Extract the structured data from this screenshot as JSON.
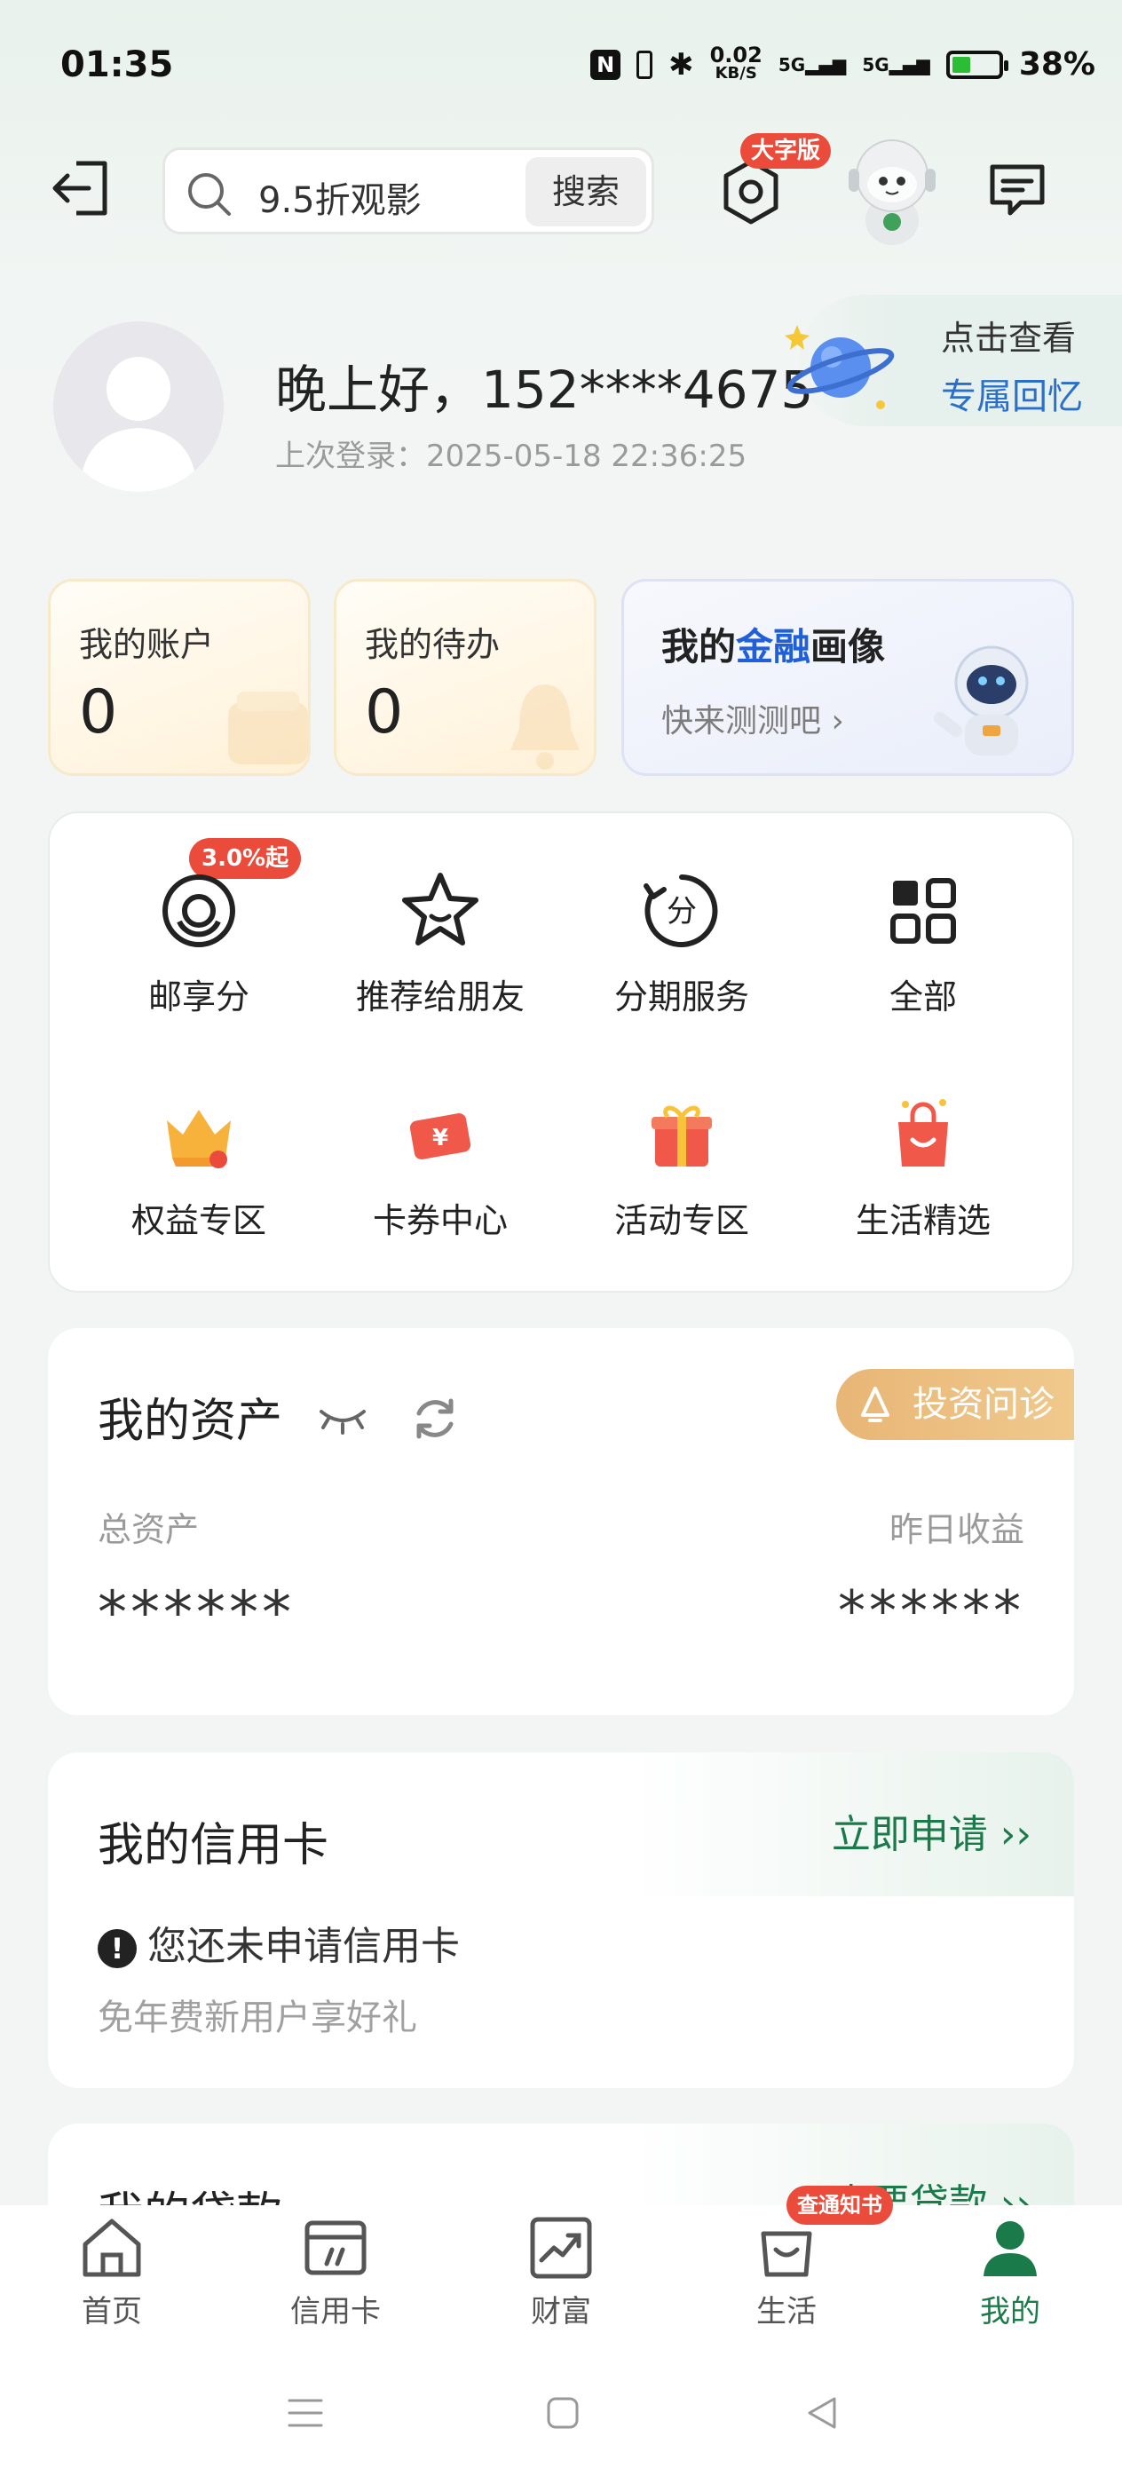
{
  "status_bar": {
    "time": "01:35",
    "net_speed": "0.02",
    "net_unit": "KB/S",
    "signal1": "5G",
    "signal2": "5G",
    "battery": "38%"
  },
  "header": {
    "search_placeholder": "9.5折观影",
    "search_button": "搜索",
    "large_font_badge": "大字版"
  },
  "greeting": {
    "text": "晚上好，152****4675",
    "last_login": "上次登录：2025-05-18 22:36:25",
    "memory_line1": "点击查看",
    "memory_line2": "专属回忆"
  },
  "summary": {
    "account_title": "我的账户",
    "account_value": "0",
    "todo_title": "我的待办",
    "todo_value": "0",
    "finance_title_pre": "我的",
    "finance_title_hl": "金融",
    "finance_title_post": "画像",
    "finance_sub": "快来测测吧"
  },
  "menu": {
    "badge": "3.0%起",
    "items": [
      {
        "label": "邮享分",
        "icon": "points-icon"
      },
      {
        "label": "推荐给朋友",
        "icon": "star-icon"
      },
      {
        "label": "分期服务",
        "icon": "installment-icon"
      },
      {
        "label": "全部",
        "icon": "grid-icon"
      },
      {
        "label": "权益专区",
        "icon": "crown-icon"
      },
      {
        "label": "卡券中心",
        "icon": "coupon-icon"
      },
      {
        "label": "活动专区",
        "icon": "gift-icon"
      },
      {
        "label": "生活精选",
        "icon": "shopping-bag-icon"
      }
    ]
  },
  "assets": {
    "title": "我的资产",
    "invest_button": "投资问诊",
    "total_label": "总资产",
    "total_value": "******",
    "yesterday_label": "昨日收益",
    "yesterday_value": "******"
  },
  "credit": {
    "title": "我的信用卡",
    "apply": "立即申请 ››",
    "notice": "您还未申请信用卡",
    "sub": "免年费新用户享好礼"
  },
  "loan": {
    "title": "我的贷款",
    "apply": "申要贷款 ››",
    "badge": "查通知书"
  },
  "bottom_nav": {
    "tabs": [
      {
        "label": "首页",
        "icon": "home-icon"
      },
      {
        "label": "信用卡",
        "icon": "credit-card-icon"
      },
      {
        "label": "财富",
        "icon": "wealth-icon"
      },
      {
        "label": "生活",
        "icon": "life-icon"
      },
      {
        "label": "我的",
        "icon": "profile-icon"
      }
    ],
    "active_color": "#1b7a4a"
  },
  "colors": {
    "brand_green": "#1b7a4a",
    "badge_red": "#ea4b3a",
    "link_blue": "#2a6fc9"
  }
}
